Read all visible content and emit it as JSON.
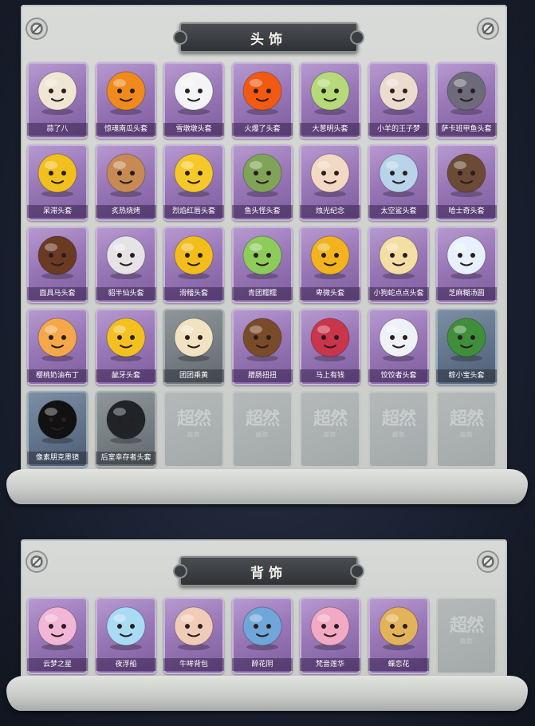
{
  "sections": [
    {
      "title": "头饰",
      "items": [
        {
          "label": "蒜了八",
          "rarity": "purple",
          "icon": "garlic-head",
          "color": "#efe6d4"
        },
        {
          "label": "惊魂南瓜头套",
          "rarity": "purple",
          "icon": "pumpkin-head",
          "color": "#f08a1c"
        },
        {
          "label": "雪墩墩头套",
          "rarity": "purple",
          "icon": "snowman-head",
          "color": "#f4f4f6"
        },
        {
          "label": "火爆了头套",
          "rarity": "purple",
          "icon": "fire-head",
          "color": "#f25a12"
        },
        {
          "label": "大葱明头套",
          "rarity": "purple",
          "icon": "leek-head",
          "color": "#b6d97a"
        },
        {
          "label": "小羊的王子梦",
          "rarity": "purple",
          "icon": "lamb-crown-head",
          "color": "#ecdccf"
        },
        {
          "label": "萨卡班甲鱼头套",
          "rarity": "purple",
          "icon": "fish-head",
          "color": "#6e6a7a"
        },
        {
          "label": "呆滞头套",
          "rarity": "purple",
          "icon": "stunned-emoji-head",
          "color": "#f2c01e"
        },
        {
          "label": "炙热烧烤",
          "rarity": "purple",
          "icon": "bbq-head",
          "color": "#c78a55"
        },
        {
          "label": "烈焰红唇头套",
          "rarity": "purple",
          "icon": "yellow-mouse-head",
          "color": "#f5c92a"
        },
        {
          "label": "鱼头怪头套",
          "rarity": "purple",
          "icon": "green-fish-head",
          "color": "#7fa457"
        },
        {
          "label": "烛光纪念",
          "rarity": "purple",
          "icon": "candle-head",
          "color": "#f3d8c4"
        },
        {
          "label": "太空鲨头套",
          "rarity": "purple",
          "icon": "shark-head",
          "color": "#b9d3ea"
        },
        {
          "label": "哈士奇头套",
          "rarity": "purple",
          "icon": "husky-head",
          "color": "#6b4a36"
        },
        {
          "label": "面具马头套",
          "rarity": "purple",
          "icon": "horse-head",
          "color": "#6a3a22"
        },
        {
          "label": "貂半仙头套",
          "rarity": "purple",
          "icon": "koala-head",
          "color": "#e6e3e6"
        },
        {
          "label": "滑稽头套",
          "rarity": "purple",
          "icon": "funny-face-head",
          "color": "#f3be1c"
        },
        {
          "label": "青团糯糯",
          "rarity": "purple",
          "icon": "green-dumpling-head",
          "color": "#8dcb5b"
        },
        {
          "label": "卑微头套",
          "rarity": "purple",
          "icon": "humble-face-head",
          "color": "#f2b31e"
        },
        {
          "label": "小狗蛇点点头套",
          "rarity": "purple",
          "icon": "snake-head",
          "color": "#f5dea4"
        },
        {
          "label": "芝麻糊汤圆",
          "rarity": "purple",
          "icon": "rice-ball-head",
          "color": "#e7f1fb"
        },
        {
          "label": "樱桃奶油布丁",
          "rarity": "purple",
          "icon": "pudding-head",
          "color": "#f4a84a"
        },
        {
          "label": "龇牙头套",
          "rarity": "purple",
          "icon": "grin-emoji-head",
          "color": "#f3c11f"
        },
        {
          "label": "团团乘黄",
          "rarity": "grey",
          "icon": "cloud-beast-head",
          "color": "#f1e3c2"
        },
        {
          "label": "腊肠扭扭",
          "rarity": "purple",
          "icon": "sausage-dog-head",
          "color": "#7a4b28"
        },
        {
          "label": "马上有钱",
          "rarity": "purple",
          "icon": "red-horse-head",
          "color": "#c9354a"
        },
        {
          "label": "饺饺者头套",
          "rarity": "purple",
          "icon": "dumpling-head",
          "color": "#eef2f6"
        },
        {
          "label": "粽小宝头套",
          "rarity": "blue",
          "icon": "zongzi-head",
          "color": "#3f8f3a"
        },
        {
          "label": "像素朋克墨镜",
          "rarity": "blue",
          "icon": "pixel-sunglasses",
          "color": "#111111"
        },
        {
          "label": "后室幸存者头套",
          "rarity": "grey",
          "icon": "gas-mask-helmet",
          "color": "#202428"
        },
        {
          "label": "",
          "rarity": "empty",
          "icon": "locked-slot"
        },
        {
          "label": "",
          "rarity": "empty",
          "icon": "locked-slot"
        },
        {
          "label": "",
          "rarity": "empty",
          "icon": "locked-slot"
        },
        {
          "label": "",
          "rarity": "empty",
          "icon": "locked-slot"
        },
        {
          "label": "",
          "rarity": "empty",
          "icon": "locked-slot"
        }
      ]
    },
    {
      "title": "背饰",
      "items": [
        {
          "label": "云梦之星",
          "rarity": "purple",
          "icon": "unicorn-wings",
          "color": "#f2b6d6"
        },
        {
          "label": "夜浮船",
          "rarity": "purple",
          "icon": "ice-ship",
          "color": "#a9dbf4"
        },
        {
          "label": "牛哞背包",
          "rarity": "purple",
          "icon": "cow-backpack",
          "color": "#f0cbb8"
        },
        {
          "label": "醉花阴",
          "rarity": "purple",
          "icon": "flower-wreath",
          "color": "#6fa7d9"
        },
        {
          "label": "梵音莲华",
          "rarity": "purple",
          "icon": "lotus-fairy",
          "color": "#f2a9c4"
        },
        {
          "label": "蝶恋花",
          "rarity": "purple",
          "icon": "butterfly-ring",
          "color": "#e2b35a"
        },
        {
          "label": "",
          "rarity": "empty",
          "icon": "locked-slot"
        }
      ]
    }
  ],
  "locked_mark": {
    "main": "超然",
    "sub": "超然"
  }
}
